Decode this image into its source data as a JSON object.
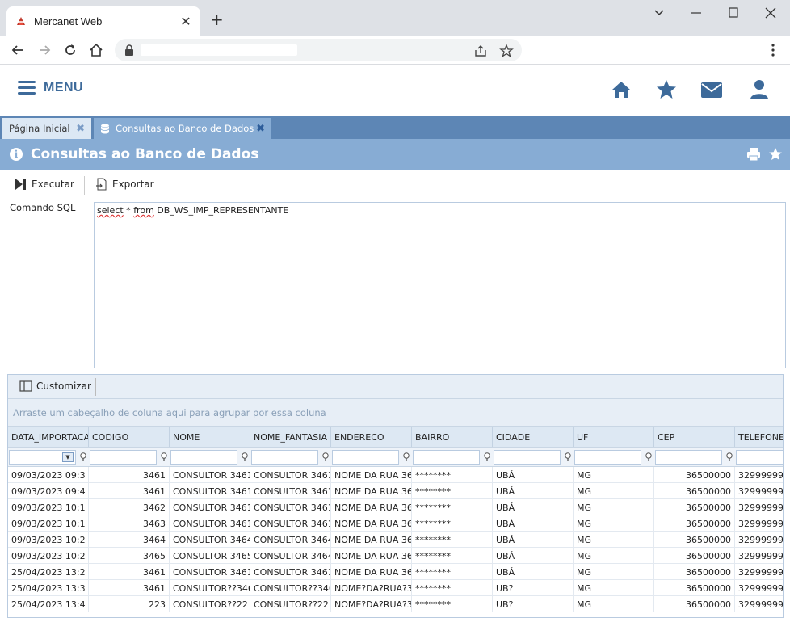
{
  "browser": {
    "tab_title": "Mercanet Web",
    "close_glyph": "✕",
    "new_tab_glyph": "+"
  },
  "header": {
    "menu_label": "MENU"
  },
  "app_tabs": [
    {
      "label": "Página Inicial"
    },
    {
      "label": "Consultas ao Banco de Dados"
    }
  ],
  "page": {
    "title": "Consultas ao Banco de Dados"
  },
  "toolbar": {
    "execute_label": "Executar",
    "export_label": "Exportar"
  },
  "sql": {
    "label": "Comando SQL",
    "keyword_select": "select",
    "star": " * ",
    "keyword_from": "from",
    "rest": " DB_WS_IMP_REPRESENTANTE"
  },
  "grid": {
    "customize_label": "Customizar",
    "group_hint": "Arraste um cabeçalho de coluna aqui para agrupar por essa coluna",
    "columns": [
      "DATA_IMPORTACAO",
      "CODIGO",
      "NOME",
      "NOME_FANTASIA",
      "ENDERECO",
      "BAIRRO",
      "CIDADE",
      "UF",
      "CEP",
      "TELEFONE"
    ],
    "rows": [
      [
        "09/03/2023 09:3",
        "3461",
        "CONSULTOR 3461",
        "CONSULTOR 3461",
        "NOME DA RUA 36",
        "********",
        "UBÁ",
        "MG",
        "36500000",
        "32999999"
      ],
      [
        "09/03/2023 09:4",
        "3461",
        "CONSULTOR 3461",
        "CONSULTOR 3461",
        "NOME DA RUA 36",
        "********",
        "UBÁ",
        "MG",
        "36500000",
        "32999999"
      ],
      [
        "09/03/2023 10:1",
        "3462",
        "CONSULTOR 3461",
        "CONSULTOR 3461",
        "NOME DA RUA 36",
        "********",
        "UBÁ",
        "MG",
        "36500000",
        "32999999"
      ],
      [
        "09/03/2023 10:1",
        "3463",
        "CONSULTOR 3461",
        "CONSULTOR 3461",
        "NOME DA RUA 36",
        "********",
        "UBÁ",
        "MG",
        "36500000",
        "32999999"
      ],
      [
        "09/03/2023 10:2",
        "3464",
        "CONSULTOR 3464",
        "CONSULTOR 3464",
        "NOME DA RUA 36",
        "********",
        "UBÁ",
        "MG",
        "36500000",
        "32999999"
      ],
      [
        "09/03/2023 10:2",
        "3465",
        "CONSULTOR 3465",
        "CONSULTOR 3464",
        "NOME DA RUA 36",
        "********",
        "UBÁ",
        "MG",
        "36500000",
        "32999999"
      ],
      [
        "25/04/2023 13:2",
        "3461",
        "CONSULTOR 3461",
        "CONSULTOR 3461",
        "NOME DA RUA 36",
        "********",
        "UBÁ",
        "MG",
        "36500000",
        "32999999"
      ],
      [
        "25/04/2023 13:3",
        "3461",
        "CONSULTOR??346",
        "CONSULTOR??346",
        "NOME?DA?RUA?3",
        "********",
        "UB?",
        "MG",
        "36500000",
        "32999999"
      ],
      [
        "25/04/2023 13:4",
        "223",
        "CONSULTOR??22",
        "CONSULTOR??22",
        "NOME?DA?RUA?3",
        "********",
        "UB?",
        "MG",
        "36500000",
        "32999999"
      ]
    ]
  },
  "colors": {
    "accent": "#3d6a9a",
    "tabbar": "#5d86b5",
    "title_bar": "#87acd4"
  }
}
